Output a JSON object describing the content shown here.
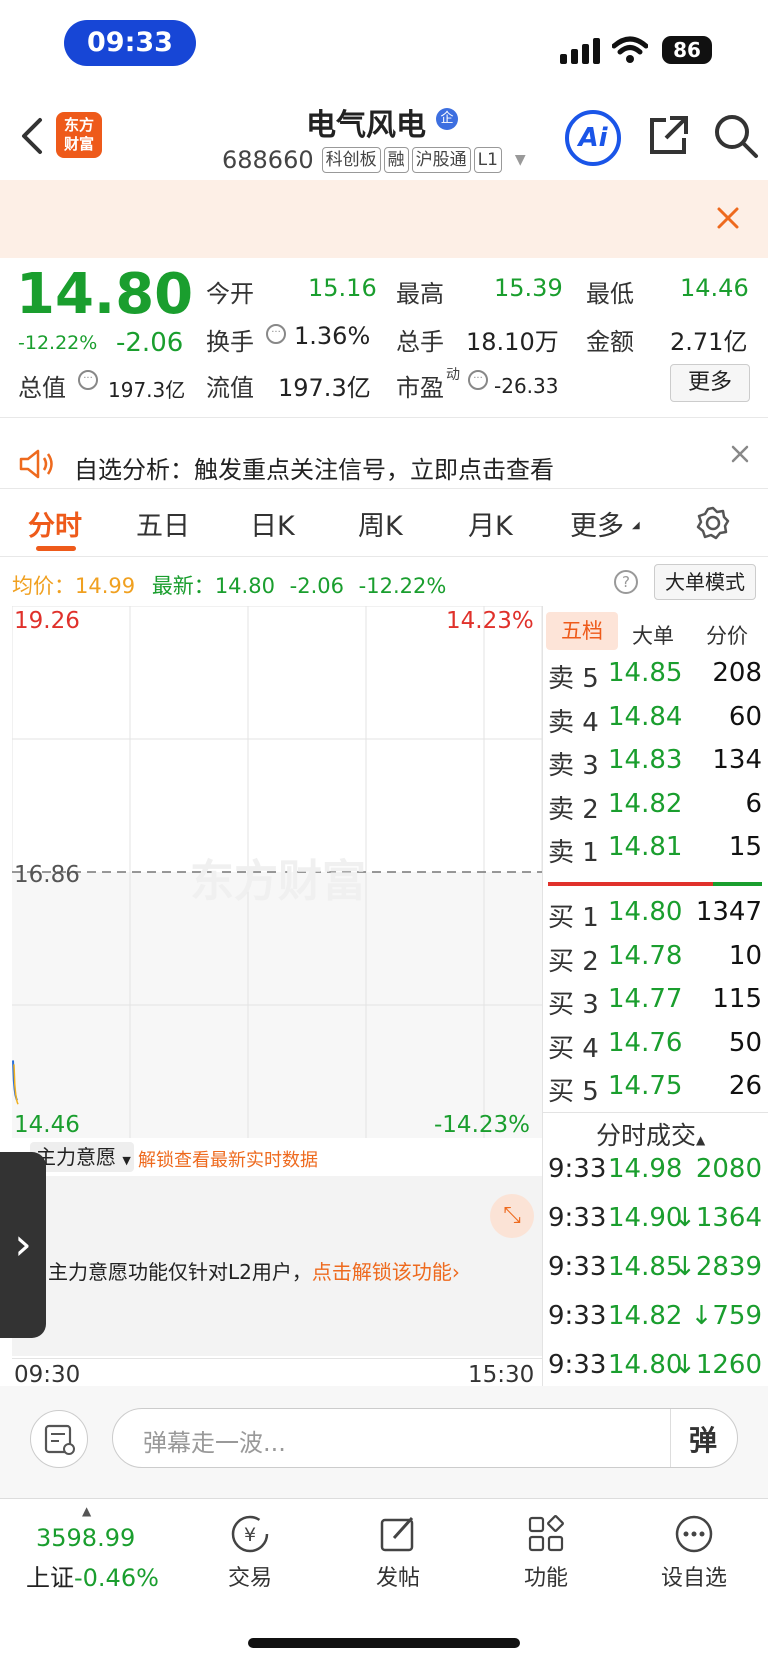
{
  "status_bar": {
    "time": "09:33",
    "battery": "86"
  },
  "header": {
    "title": "电气风电",
    "badge": "企",
    "code": "688660",
    "tags": [
      "科创板",
      "融",
      "沪股通",
      "L1"
    ],
    "logo_text_line1": "东方",
    "logo_text_line2": "财富",
    "ai_label": "Ai"
  },
  "quote": {
    "price": "14.80",
    "change_pct": "-12.22%",
    "change": "-2.06",
    "open_label": "今开",
    "open": "15.16",
    "high_label": "最高",
    "high": "15.39",
    "low_label": "最低",
    "low": "14.46",
    "turnover_label": "换手",
    "turnover": "1.36%",
    "volume_label": "总手",
    "volume": "18.10万",
    "amount_label": "金额",
    "amount": "2.71亿",
    "mktcap_label": "总值",
    "mktcap": "197.3亿",
    "float_label": "流值",
    "float_cap": "197.3亿",
    "pe_label": "市盈",
    "pe_sup": "动",
    "pe": "-26.33",
    "more_label": "更多"
  },
  "alert": {
    "text": "自选分析：触发重点关注信号，立即点击查看"
  },
  "tabs": [
    {
      "label": "分时"
    },
    {
      "label": "五日"
    },
    {
      "label": "日K"
    },
    {
      "label": "周K"
    },
    {
      "label": "月K"
    },
    {
      "label": "更多"
    }
  ],
  "chart_info": {
    "avg_label": "均价：",
    "avg": "14.99",
    "latest_label": "最新：",
    "latest": "14.80",
    "latest_change": "-2.06",
    "latest_pct": "-12.22%",
    "mode_button": "大单模式"
  },
  "chart_data": {
    "type": "line",
    "title": "",
    "ylim": [
      14.46,
      19.26
    ],
    "y_top_label": "19.26",
    "y_mid_label": "16.86",
    "y_bottom_label": "14.46",
    "pct_top_label": "14.23%",
    "pct_bottom_label": "-14.23%",
    "x_start_label": "09:30",
    "x_end_label": "15:30",
    "series": [
      {
        "values": [
          15.16,
          14.98,
          14.9,
          14.85,
          14.82,
          14.8
        ]
      }
    ],
    "watermark": "东方财富"
  },
  "orderbook": {
    "tabs": [
      "五档",
      "大单",
      "分价"
    ],
    "asks": [
      {
        "label": "卖 5",
        "price": "14.85",
        "vol": "208"
      },
      {
        "label": "卖 4",
        "price": "14.84",
        "vol": "60"
      },
      {
        "label": "卖 3",
        "price": "14.83",
        "vol": "134"
      },
      {
        "label": "卖 2",
        "price": "14.82",
        "vol": "6"
      },
      {
        "label": "卖 1",
        "price": "14.81",
        "vol": "15"
      }
    ],
    "bids": [
      {
        "label": "买 1",
        "price": "14.80",
        "vol": "1347"
      },
      {
        "label": "买 2",
        "price": "14.78",
        "vol": "10"
      },
      {
        "label": "买 3",
        "price": "14.77",
        "vol": "115"
      },
      {
        "label": "买 4",
        "price": "14.76",
        "vol": "50"
      },
      {
        "label": "买 5",
        "price": "14.75",
        "vol": "26"
      }
    ],
    "ask_ratio": 0.77
  },
  "trades": {
    "title": "分时成交",
    "rows": [
      {
        "time": "9:33",
        "price": "14.98",
        "vol": "2080",
        "arrow": ""
      },
      {
        "time": "9:33",
        "price": "14.90",
        "vol": "1364",
        "arrow": "↓"
      },
      {
        "time": "9:33",
        "price": "14.85",
        "vol": "2839",
        "arrow": "↓"
      },
      {
        "time": "9:33",
        "price": "14.82",
        "vol": "759",
        "arrow": "↓"
      },
      {
        "time": "9:33",
        "price": "14.80",
        "vol": "1260",
        "arrow": "↓"
      }
    ]
  },
  "main_force": {
    "dropdown": "主力意愿",
    "unlock_link": "解锁查看最新实时数据",
    "message": "主力意愿功能仅针对L2用户，",
    "message_link": "点击解锁该功能"
  },
  "comment": {
    "placeholder": "弹幕走一波...",
    "danmu_label": "弹"
  },
  "bottom_nav": {
    "index_value": "3598.99",
    "index_name": "上证",
    "index_change": "-0.46%",
    "items": [
      "交易",
      "发帖",
      "功能",
      "设自选"
    ]
  },
  "colors": {
    "up": "#e0312b",
    "down": "#1a9e2e",
    "accent": "#ee6a1e",
    "brand": "#1a55e8"
  }
}
